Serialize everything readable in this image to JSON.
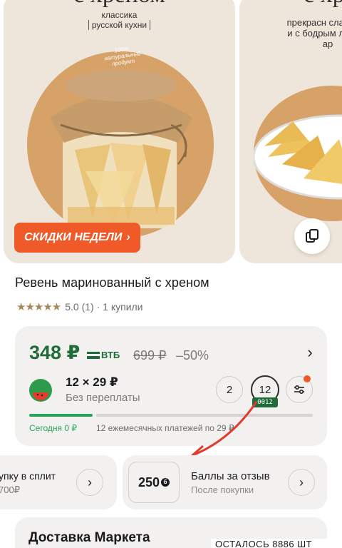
{
  "gallery": {
    "card1": {
      "title_fragment": "с хреном",
      "subtitle_line1": "классика",
      "subtitle_line2": "русской кухни",
      "badge_text": "100% натуральный продукт",
      "sale_label": "СКИДКИ НЕДЕЛИ",
      "sale_chevron": "›"
    },
    "card2": {
      "title_fragment": "с хр",
      "text": "прекрасн сладости и с бодрым легким ар"
    },
    "view_icon": "gallery-view-icon"
  },
  "product": {
    "title": "Ревень маринованный с хреном",
    "stars": "★★★★★",
    "rating_text": "5.0 (1) · 1 купили"
  },
  "price_card": {
    "price": "348 ₽",
    "bank": "ВТБ",
    "old_price": "699 ₽",
    "discount": "–50%",
    "chevron": "›",
    "split": {
      "per_payment": "12 × 29 ₽",
      "subtitle": "Без переплаты",
      "terms": [
        "2",
        "12"
      ],
      "selected_tag": "0012",
      "filter_icon": "sliders-icon",
      "progress": 0.23,
      "today_label": "Сегодня 0 ₽",
      "monthly_label": "12 ежемесячных платежей по 29 ₽"
    }
  },
  "split_card": {
    "title": "упку в сплит",
    "subtitle": "700₽",
    "chevron": "›"
  },
  "review_card": {
    "points": "250",
    "coin_symbol": "б",
    "title": "Баллы за отзыв",
    "subtitle": "После покупки",
    "chevron": "›"
  },
  "delivery": {
    "title": "Доставка Маркета",
    "stock_text": "ОСТАЛОСЬ 8886 ШТ"
  },
  "colors": {
    "accent_green": "#1f6b3a",
    "progress_green": "#29a35a",
    "sale_orange": "#f05a28",
    "card_bg": "#f2f1ef",
    "annotation_red": "#e13b2e"
  }
}
